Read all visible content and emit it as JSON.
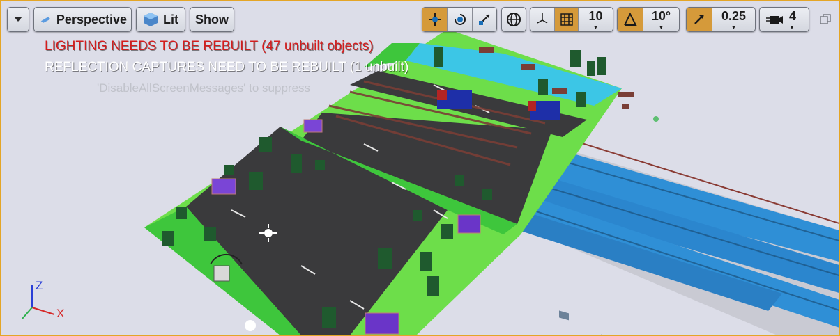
{
  "viewport": {
    "view_mode": "Perspective",
    "lighting_mode": "Lit",
    "show_label": "Show",
    "grid_snap_value": "10",
    "rotation_snap_value": "10°",
    "scale_snap_value": "0.25",
    "camera_speed_value": "4"
  },
  "messages": {
    "lighting": "LIGHTING NEEDS TO BE REBUILT (47 unbuilt objects)",
    "reflection": "REFLECTION CAPTURES NEED TO BE REBUILT (1 unbuilt)",
    "suppress": "'DisableAllScreenMessages' to suppress"
  },
  "axes": {
    "x": "X",
    "z": "Z"
  },
  "colors": {
    "accent": "#d59a3a",
    "viewport_border": "#e4a526",
    "error_text": "#d41d1d",
    "grass_light": "#6dde4a",
    "grass_dark": "#3ec63c",
    "road": "#3a3a3c",
    "water": "#3cc6e6",
    "train": "#2f8fd6"
  }
}
